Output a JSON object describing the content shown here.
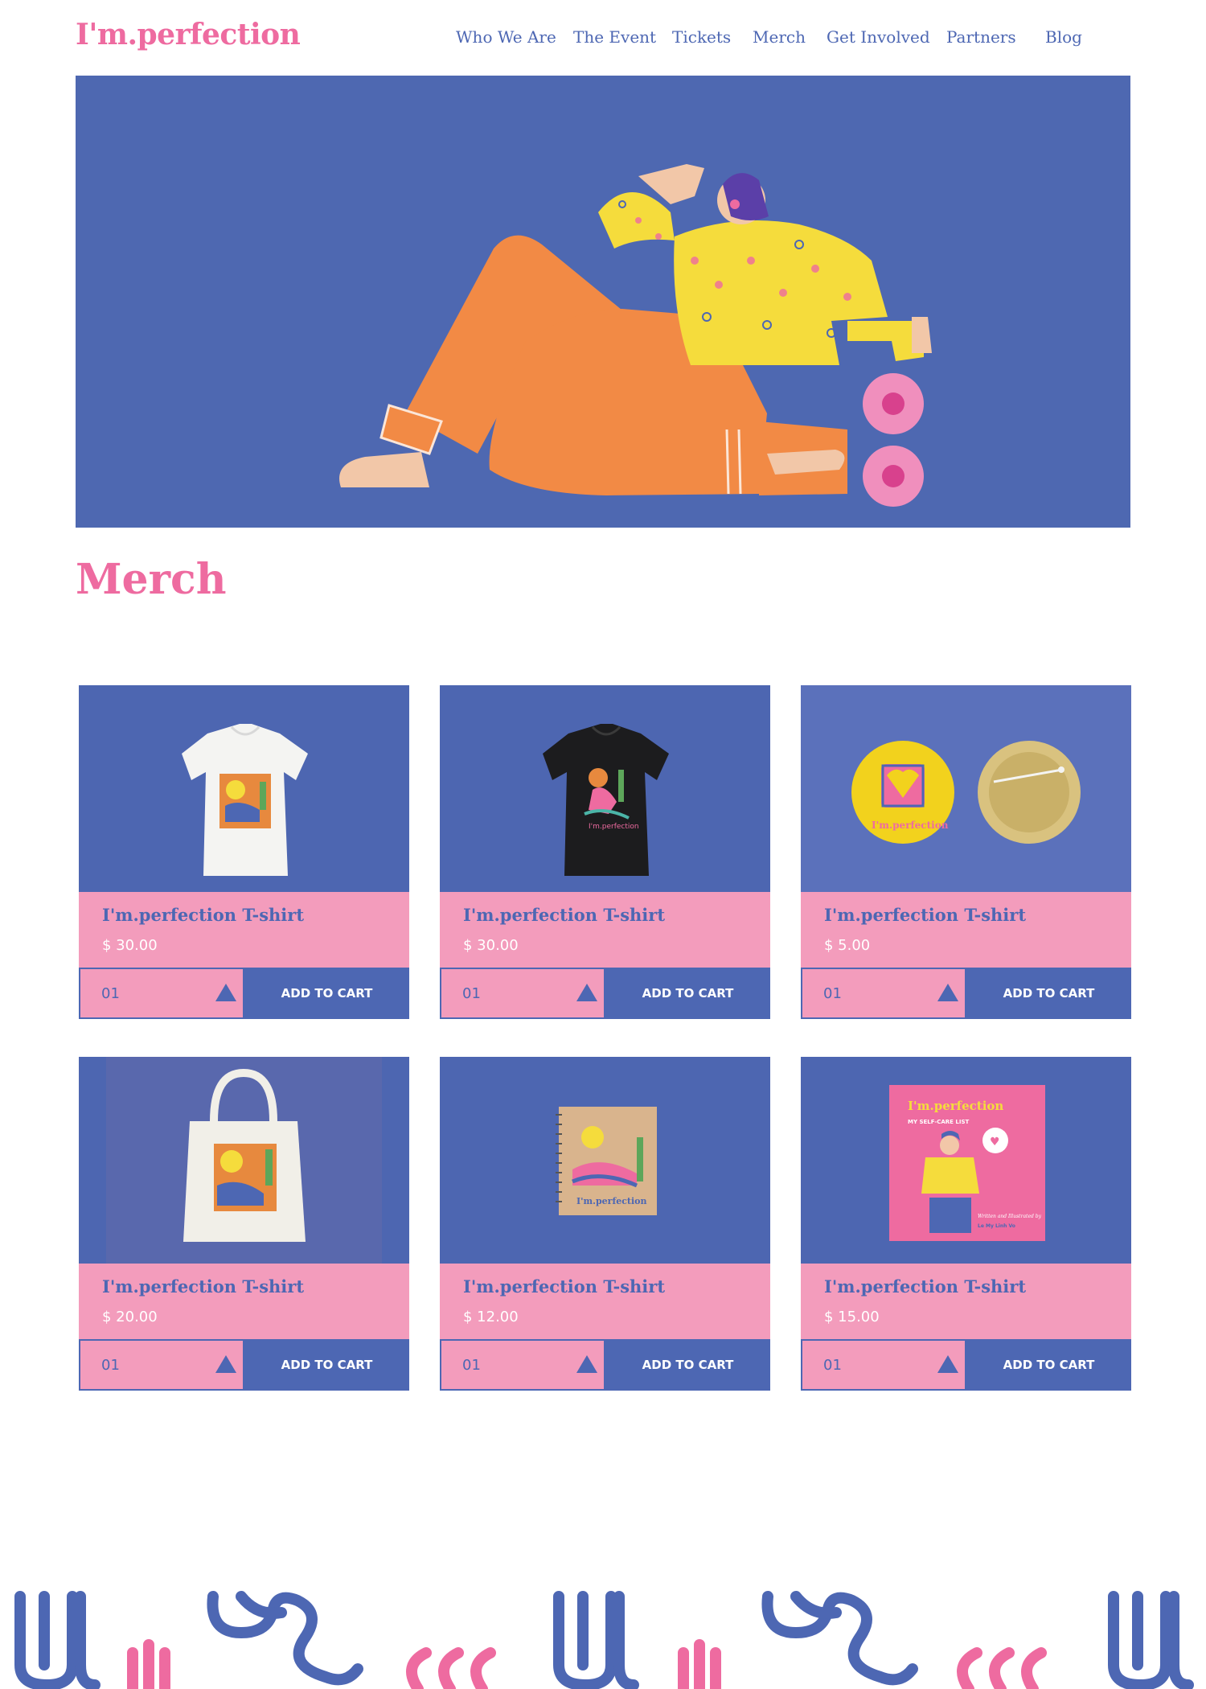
{
  "header": {
    "logo": "I'm.perfection",
    "nav": [
      {
        "label": "Who We Are"
      },
      {
        "label": "The Event"
      },
      {
        "label": "Tickets"
      },
      {
        "label": "Merch"
      },
      {
        "label": "Get Involved"
      },
      {
        "label": "Partners"
      },
      {
        "label": "Blog"
      }
    ]
  },
  "page": {
    "title": "Merch"
  },
  "products": [
    {
      "name": "I'm.perfection T-shirt",
      "price": "$ 30.00",
      "qty": "01",
      "cta": "ADD TO CART",
      "image": "white-tshirt"
    },
    {
      "name": "I'm.perfection T-shirt",
      "price": "$ 30.00",
      "qty": "01",
      "cta": "ADD TO CART",
      "image": "black-tshirt"
    },
    {
      "name": "I'm.perfection T-shirt",
      "price": "$ 5.00",
      "qty": "01",
      "cta": "ADD TO CART",
      "image": "pin-buttons"
    },
    {
      "name": "I'm.perfection T-shirt",
      "price": "$ 20.00",
      "qty": "01",
      "cta": "ADD TO CART",
      "image": "tote-bag"
    },
    {
      "name": "I'm.perfection T-shirt",
      "price": "$ 12.00",
      "qty": "01",
      "cta": "ADD TO CART",
      "image": "notebook"
    },
    {
      "name": "I'm.perfection T-shirt",
      "price": "$ 15.00",
      "qty": "01",
      "cta": "ADD TO CART",
      "image": "book"
    }
  ],
  "product_art": {
    "pin": "I'm.perfection",
    "notebook": "I'm.perfection",
    "book_title": "I'm.perfection",
    "book_subtitle": "MY SELF-CARE LIST",
    "book_credit": "Written and Illustrated by",
    "book_author": "Le My Linh Vo"
  },
  "colors": {
    "brand_pink": "#ee6ba0",
    "brand_blue": "#4d67b3",
    "card_pink": "#f39cbc",
    "hero_blue": "#4e68b1"
  }
}
